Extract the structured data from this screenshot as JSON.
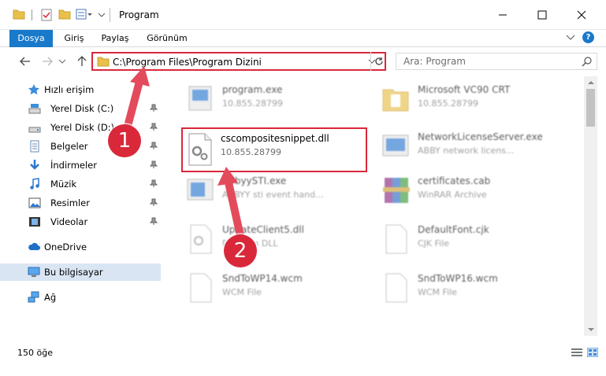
{
  "window": {
    "title": "Program",
    "icons": [
      "folder-icon",
      "properties-icon",
      "new-folder-icon",
      "customize-icon"
    ],
    "controls": [
      "minimize-icon",
      "maximize-icon",
      "close-icon"
    ]
  },
  "ribbon": {
    "tabs": [
      "Dosya",
      "Giriş",
      "Paylaş",
      "Görünüm"
    ],
    "help_label": "?"
  },
  "address": {
    "path": "C:\\Program Files\\Program Dizini",
    "search_placeholder": "Ara: Program"
  },
  "sidebar": {
    "quick_access": "Hızlı erişim",
    "items": [
      {
        "label": "Yerel Disk (C:)",
        "icon": "drive-icon"
      },
      {
        "label": "Yerel Disk (D:)",
        "icon": "drive-icon"
      },
      {
        "label": "Belgeler",
        "icon": "documents-icon"
      },
      {
        "label": "İndirmeler",
        "icon": "downloads-icon"
      },
      {
        "label": "Müzik",
        "icon": "music-icon"
      },
      {
        "label": "Resimler",
        "icon": "pictures-icon"
      },
      {
        "label": "Videolar",
        "icon": "videos-icon"
      }
    ],
    "onedrive": "OneDrive",
    "this_pc": "Bu bilgisayar",
    "network": "Ağ"
  },
  "files": [
    {
      "name": "program.exe",
      "sub": "10.855.28799",
      "icon": "exe-icon"
    },
    {
      "name": "Microsoft VC90 CRT",
      "sub": "10.855.28799",
      "icon": "folder-icon"
    },
    {
      "name": "cscompositesnippet.dll",
      "sub": "10.855.28799",
      "icon": "dll-icon"
    },
    {
      "name": "NetworkLicenseServer.exe",
      "sub": "ABBY network licens...",
      "icon": "exe-icon"
    },
    {
      "name": "AbbyySTI.exe",
      "sub": "ABBYY sti event hand...",
      "icon": "exe-icon"
    },
    {
      "name": "certificates.cab",
      "sub": "WinRAR Archive",
      "icon": "archive-icon"
    },
    {
      "name": "UpdateClient5.dll",
      "sub": "Program DLL",
      "icon": "dll-icon"
    },
    {
      "name": "DefaultFont.cjk",
      "sub": "CJK File",
      "icon": "file-icon"
    },
    {
      "name": "SndToWP14.wcm",
      "sub": "WCM File",
      "icon": "file-icon"
    },
    {
      "name": "SndToWP16.wcm",
      "sub": "WCM File",
      "icon": "file-icon"
    }
  ],
  "status": {
    "count": "150 öğe"
  },
  "callouts": [
    "1",
    "2"
  ],
  "colors": {
    "accent": "#1979ca",
    "highlight": "#d9283a",
    "selected": "#d9e5f3"
  }
}
